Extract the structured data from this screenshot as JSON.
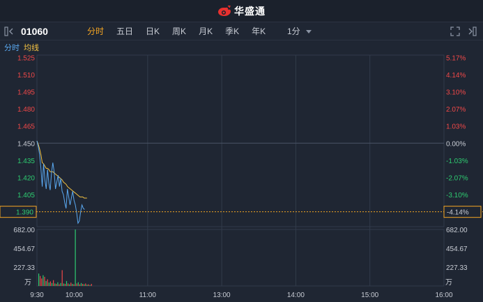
{
  "app": {
    "brand_name": "华盛通"
  },
  "toolbar": {
    "stock_code": "01060",
    "tabs": [
      {
        "label": "分时",
        "active": true
      },
      {
        "label": "五日",
        "active": false
      },
      {
        "label": "日K",
        "active": false
      },
      {
        "label": "周K",
        "active": false
      },
      {
        "label": "月K",
        "active": false
      },
      {
        "label": "季K",
        "active": false
      },
      {
        "label": "年K",
        "active": false
      }
    ],
    "interval": "1分",
    "icons": {
      "collapse": "panel-collapse-icon",
      "expand": "fullscreen-icon",
      "side": "side-panel-icon"
    }
  },
  "legend": [
    {
      "label": "分时",
      "color": "#5aa8f0"
    },
    {
      "label": "均线",
      "color": "#f5c342"
    }
  ],
  "colors": {
    "up": "#f04848",
    "down": "#2ecc71",
    "neutral": "#c8ccd4",
    "price_line": "#5aa8f0",
    "avg_line": "#f5c342",
    "accent": "#f5a623"
  },
  "chart_data": {
    "type": "line",
    "prev_close": 1.45,
    "current_price": "1.390",
    "current_pct": "-4.14%",
    "price_ticks": [
      "1.525",
      "1.510",
      "1.495",
      "1.480",
      "1.465",
      "1.450",
      "1.435",
      "1.420",
      "1.405",
      "1.390"
    ],
    "pct_ticks": [
      "5.17%",
      "4.14%",
      "3.10%",
      "2.07%",
      "1.03%",
      "0.00%",
      "-1.03%",
      "-2.07%",
      "-3.10%",
      "-4.14%"
    ],
    "price_range": [
      1.377,
      1.527
    ],
    "volume_ticks": [
      "682.00",
      "454.67",
      "227.33"
    ],
    "volume_unit": "万",
    "volume_range": [
      0,
      682
    ],
    "time_labels": [
      "9:30",
      "10:00",
      "11:00",
      "13:00",
      "14:00",
      "15:00",
      "16:00"
    ],
    "minutes_total": 390,
    "price_series": [
      1.452,
      1.447,
      1.44,
      1.428,
      1.412,
      1.432,
      1.418,
      1.41,
      1.427,
      1.415,
      1.409,
      1.424,
      1.433,
      1.425,
      1.41,
      1.416,
      1.422,
      1.412,
      1.419,
      1.408,
      1.405,
      1.398,
      1.393,
      1.41,
      1.403,
      1.396,
      1.402,
      1.408,
      1.4,
      1.396,
      1.389,
      1.38,
      1.382,
      1.39,
      1.396,
      1.393,
      1.392
    ],
    "avg_series": [
      1.452,
      1.449,
      1.445,
      1.44,
      1.433,
      1.432,
      1.43,
      1.428,
      1.428,
      1.427,
      1.425,
      1.425,
      1.425,
      1.424,
      1.423,
      1.422,
      1.421,
      1.42,
      1.419,
      1.418,
      1.416,
      1.414,
      1.412,
      1.411,
      1.41,
      1.409,
      1.408,
      1.407,
      1.406,
      1.405,
      1.404,
      1.403,
      1.403,
      1.403,
      1.402,
      1.402,
      1.402
    ],
    "volumes": [
      {
        "v": 150,
        "dir": "down"
      },
      {
        "v": 120,
        "dir": "up"
      },
      {
        "v": 90,
        "dir": "up"
      },
      {
        "v": 130,
        "dir": "down"
      },
      {
        "v": 110,
        "dir": "up"
      },
      {
        "v": 60,
        "dir": "down"
      },
      {
        "v": 80,
        "dir": "up"
      },
      {
        "v": 40,
        "dir": "down"
      },
      {
        "v": 55,
        "dir": "up"
      },
      {
        "v": 35,
        "dir": "down"
      },
      {
        "v": 70,
        "dir": "up"
      },
      {
        "v": 30,
        "dir": "down"
      },
      {
        "v": 25,
        "dir": "up"
      },
      {
        "v": 45,
        "dir": "down"
      },
      {
        "v": 20,
        "dir": "up"
      },
      {
        "v": 35,
        "dir": "down"
      },
      {
        "v": 190,
        "dir": "up"
      },
      {
        "v": 30,
        "dir": "down"
      },
      {
        "v": 25,
        "dir": "up"
      },
      {
        "v": 60,
        "dir": "down"
      },
      {
        "v": 30,
        "dir": "up"
      },
      {
        "v": 20,
        "dir": "down"
      },
      {
        "v": 40,
        "dir": "up"
      },
      {
        "v": 25,
        "dir": "down"
      },
      {
        "v": 20,
        "dir": "up"
      },
      {
        "v": 682,
        "dir": "down"
      },
      {
        "v": 30,
        "dir": "up"
      },
      {
        "v": 45,
        "dir": "down"
      },
      {
        "v": 20,
        "dir": "up"
      },
      {
        "v": 35,
        "dir": "down"
      },
      {
        "v": 25,
        "dir": "up"
      },
      {
        "v": 20,
        "dir": "down"
      },
      {
        "v": 30,
        "dir": "up"
      },
      {
        "v": 15,
        "dir": "down"
      },
      {
        "v": 20,
        "dir": "up"
      },
      {
        "v": 10,
        "dir": "down"
      },
      {
        "v": 25,
        "dir": "up"
      }
    ]
  }
}
